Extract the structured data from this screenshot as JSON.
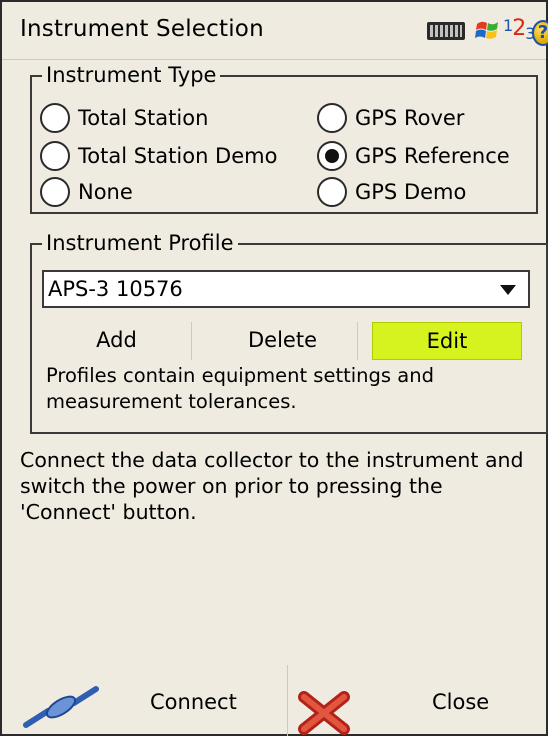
{
  "title": "Instrument Selection",
  "status_icons": [
    "keyboard-icon",
    "windows-flag-icon",
    "input-mode-123-icon",
    "help-icon"
  ],
  "input_mode": {
    "a": "1",
    "b": "2",
    "c": "3"
  },
  "instrument_type": {
    "legend": "Instrument Type",
    "options": [
      {
        "label": "Total Station",
        "checked": false
      },
      {
        "label": "GPS Rover",
        "checked": false
      },
      {
        "label": "Total Station Demo",
        "checked": false
      },
      {
        "label": "GPS Reference",
        "checked": true
      },
      {
        "label": "None",
        "checked": false
      },
      {
        "label": "GPS Demo",
        "checked": false
      }
    ]
  },
  "instrument_profile": {
    "legend": "Instrument Profile",
    "selected": "APS-3 10576",
    "add_label": "Add",
    "delete_label": "Delete",
    "edit_label": "Edit",
    "note": "Profiles contain equipment settings and measurement tolerances."
  },
  "instructions": "Connect the data collector to the instrument and switch the power on prior to pressing the 'Connect' button.",
  "bottom": {
    "connect_label": "Connect",
    "close_label": "Close"
  },
  "colors": {
    "edit_button": "#d6f21f",
    "background": "#efebe0",
    "close_x": "#d33a2c",
    "connect_cable": "#2f5fb0"
  }
}
